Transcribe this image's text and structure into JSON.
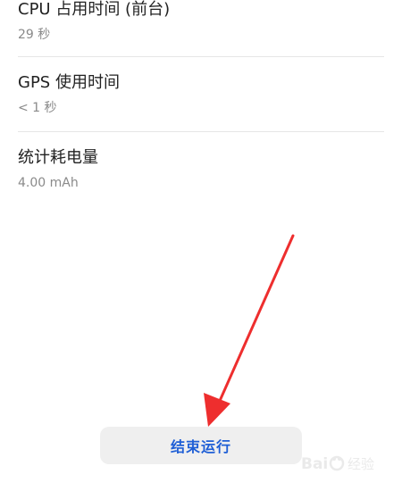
{
  "stats": [
    {
      "title": "CPU 占用时间 (前台)",
      "value": "29 秒"
    },
    {
      "title": "GPS 使用时间",
      "value": "< 1 秒"
    },
    {
      "title": "统计耗电量",
      "value": "4.00 mAh"
    }
  ],
  "actions": {
    "end_button_label": "结束运行"
  },
  "annotation": {
    "arrow_color": "#ee2e2e"
  },
  "watermark": {
    "text": "Bai 经验"
  }
}
